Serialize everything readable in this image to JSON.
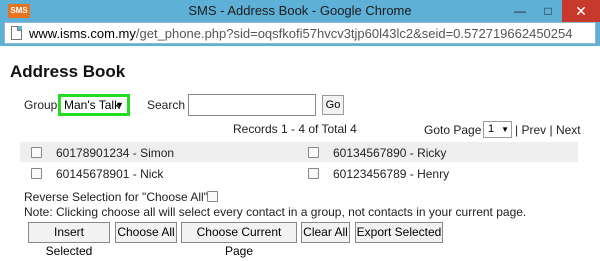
{
  "window": {
    "icon_label": "SMS",
    "title": "SMS - Address Book - Google Chrome",
    "url_host": "www.isms.com.my",
    "url_path": "/get_phone.php?sid=oqsfkofi57hvcv3tjp60l43lc2&seid=0.572719662450254"
  },
  "page": {
    "title": "Address Book",
    "group_label": "Group",
    "group_value": "Man's Talk",
    "search_label": "Search",
    "search_value": "",
    "go_label": "Go",
    "records_text": "Records 1 - 4 of Total 4",
    "goto_label": "Goto Page",
    "page_value": "1",
    "prev_label": "Prev",
    "next_label": "Next",
    "contacts": [
      "60178901234 - Simon",
      "60134567890 - Ricky",
      "60145678901 - Nick",
      "60123456789 - Henry"
    ],
    "reverse_label": "Reverse Selection for \"Choose All\"",
    "note": "Note: Clicking choose all will select every contact in a group, not contacts in your current page.",
    "buttons": {
      "insert_selected": "Insert Selected",
      "choose_all": "Choose All",
      "choose_current_page": "Choose Current Page",
      "clear_all": "Clear All",
      "export_selected": "Export Selected"
    }
  },
  "colors": {
    "titlebar": "#5eb0d6",
    "group_highlight": "#22dd22",
    "close_button": "#c7382d"
  }
}
